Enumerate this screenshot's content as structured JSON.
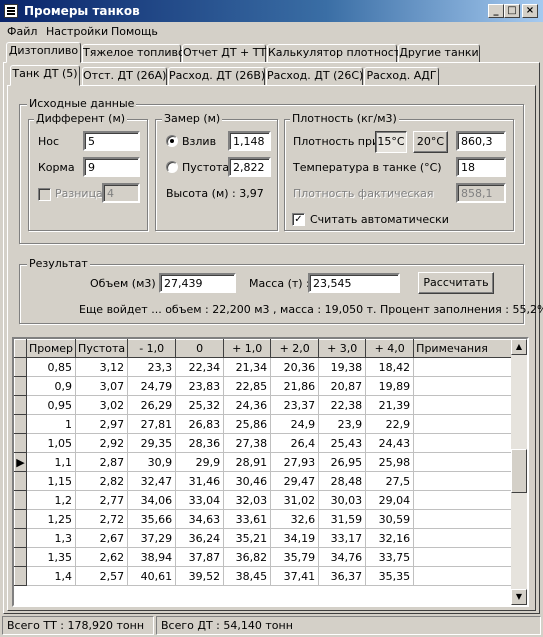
{
  "window": {
    "title": "Промеры танков",
    "minimize_glyph": "_",
    "maximize_glyph": "□",
    "close_glyph": "×"
  },
  "menu": [
    "Файл",
    "Настройки",
    "Помощь"
  ],
  "main_tabs": [
    "Дизтопливо",
    "Тяжелое топливо",
    "Отчет ДТ + ТТ",
    "Кальку­лятор плотности",
    "Другие танки"
  ],
  "sub_tabs": [
    "Танк ДТ (5)",
    "Отст. ДТ (26А)",
    "Расход. ДТ (26В)",
    "Расход. ДТ (26С)",
    "Расход. АДГ"
  ],
  "input": {
    "group_label": "Исходные данные",
    "trim": {
      "label": "Дифферент (м)",
      "bow_label": "Нос",
      "bow_value": "5",
      "stern_label": "Корма",
      "stern_value": "9",
      "diff_label": "Разница",
      "diff_value": "4"
    },
    "sounding": {
      "label": "Замер (м)",
      "ullage_label": "Взлив",
      "ullage_value": "1,148",
      "empty_label": "Пустота",
      "empty_value": "2,822",
      "height_text": "Высота (м) : 3,97"
    },
    "density": {
      "label": "Плотность (кг/м3)",
      "density_at_label": "Плотность при",
      "temp_15_label": "15°C",
      "temp_20_label": "20°C",
      "density_value": "860,3",
      "tank_temp_label": "Температура в танке (°C)",
      "tank_temp_value": "18",
      "actual_label": "Плотность фактическая",
      "actual_value": "858,1",
      "auto_label": "Считать автоматически",
      "checkmark": "✓"
    }
  },
  "result": {
    "group_label": "Результат",
    "volume_label": "Объем (м3) :",
    "volume_value": "27,439",
    "mass_label": "Масса (т) :",
    "mass_value": "23,545",
    "calc_button": "Рассчитать",
    "summary": "Еще войдет ... объем : 22,200 м3 , масса : 19,050 т.   Процент заполнения : 55,2%"
  },
  "table": {
    "headers": [
      "Промер",
      "Пустота",
      "- 1,0",
      "0",
      "+ 1,0",
      "+ 2,0",
      "+ 3,0",
      "+ 4,0",
      "Примечания"
    ],
    "current_row_marker": "▶",
    "rows": [
      [
        "0,85",
        "3,12",
        "23,3",
        "22,34",
        "21,34",
        "20,36",
        "19,38",
        "18,42",
        ""
      ],
      [
        "0,9",
        "3,07",
        "24,79",
        "23,83",
        "22,85",
        "21,86",
        "20,87",
        "19,89",
        ""
      ],
      [
        "0,95",
        "3,02",
        "26,29",
        "25,32",
        "24,36",
        "23,37",
        "22,38",
        "21,39",
        ""
      ],
      [
        "1",
        "2,97",
        "27,81",
        "26,83",
        "25,86",
        "24,9",
        "23,9",
        "22,9",
        ""
      ],
      [
        "1,05",
        "2,92",
        "29,35",
        "28,36",
        "27,38",
        "26,4",
        "25,43",
        "24,43",
        ""
      ],
      [
        "1,1",
        "2,87",
        "30,9",
        "29,9",
        "28,91",
        "27,93",
        "26,95",
        "25,98",
        ""
      ],
      [
        "1,15",
        "2,82",
        "32,47",
        "31,46",
        "30,46",
        "29,47",
        "28,48",
        "27,5",
        ""
      ],
      [
        "1,2",
        "2,77",
        "34,06",
        "33,04",
        "32,03",
        "31,02",
        "30,03",
        "29,04",
        ""
      ],
      [
        "1,25",
        "2,72",
        "35,66",
        "34,63",
        "33,61",
        "32,6",
        "31,59",
        "30,59",
        ""
      ],
      [
        "1,3",
        "2,67",
        "37,29",
        "36,24",
        "35,21",
        "34,19",
        "33,17",
        "32,16",
        ""
      ],
      [
        "1,35",
        "2,62",
        "38,94",
        "37,87",
        "36,82",
        "35,79",
        "34,76",
        "33,75",
        ""
      ],
      [
        "1,4",
        "2,57",
        "40,61",
        "39,52",
        "38,45",
        "37,41",
        "36,37",
        "35,35",
        ""
      ]
    ],
    "current_row_index": 5,
    "scroll_up_glyph": "▲",
    "scroll_down_glyph": "▼"
  },
  "status": {
    "total_tt": "Всего ТТ : 178,920 тонн",
    "total_dt": "Всего ДТ : 54,140 тонн"
  }
}
